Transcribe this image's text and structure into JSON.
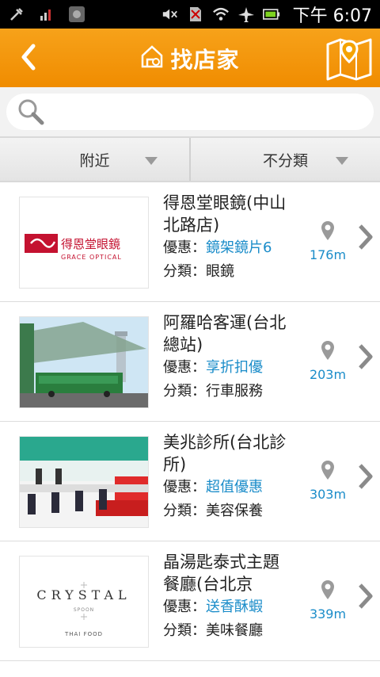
{
  "status": {
    "time": "下午 6:07"
  },
  "header": {
    "title": "找店家"
  },
  "search": {
    "placeholder": ""
  },
  "filters": {
    "left": "附近",
    "right": "不分類"
  },
  "labels": {
    "promo": "優惠：",
    "category": "分類："
  },
  "stores": [
    {
      "name": "得恩堂眼鏡(中山北路店)",
      "promo": "鏡架鏡片6",
      "category": "眼鏡",
      "distance": "176m",
      "logo_main": "得恩堂眼鏡",
      "logo_sub": "GRACE OPTICAL"
    },
    {
      "name": "阿羅哈客運(台北總站)",
      "promo": "享折扣優",
      "category": "行車服務",
      "distance": "203m"
    },
    {
      "name": "美兆診所(台北診所)",
      "promo": "超值優惠",
      "category": "美容保養",
      "distance": "303m"
    },
    {
      "name": "晶湯匙泰式主題餐廳(台北京",
      "promo": "送香酥蝦",
      "category": "美味餐廳",
      "distance": "339m",
      "logo_main": "CRYSTAL",
      "logo_mid": "SPOON",
      "logo_sub": "THAI FOOD"
    }
  ],
  "colors": {
    "header": "#f08c00",
    "link": "#1a8cc9"
  }
}
